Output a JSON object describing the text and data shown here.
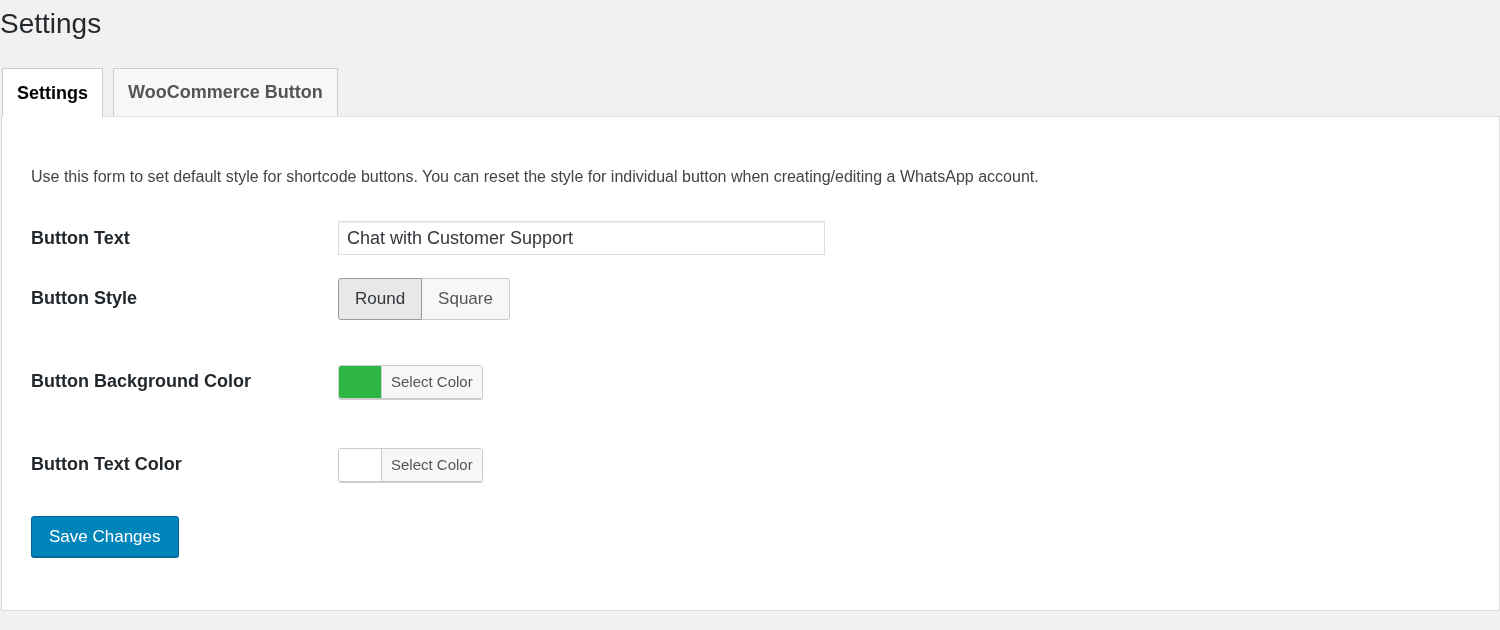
{
  "page_title": "Settings",
  "tabs": [
    {
      "label": "Settings",
      "selected": true
    },
    {
      "label": "WooCommerce Button",
      "selected": false
    }
  ],
  "description": "Use this form to set default style for shortcode buttons. You can reset the style for individual button when creating/editing a WhatsApp account.",
  "fields": [
    {
      "kind": "text",
      "label": "Button Text",
      "value": "Chat with Customer Support"
    },
    {
      "kind": "segmented",
      "label": "Button Style",
      "options": [
        {
          "label": "Round",
          "selected": true
        },
        {
          "label": "Square",
          "selected": false
        }
      ]
    },
    {
      "kind": "color",
      "label": "Button Background Color",
      "color": "#2db742",
      "button": "Select Color"
    },
    {
      "kind": "color",
      "label": "Button Text Color",
      "color": "#ffffff",
      "button": "Select Color"
    }
  ],
  "save_button": "Save Changes"
}
